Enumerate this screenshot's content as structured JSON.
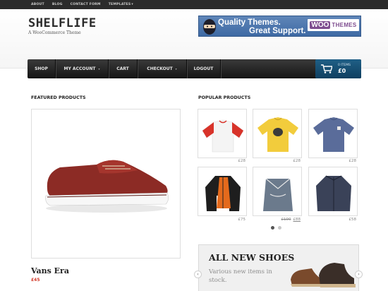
{
  "topbar": {
    "links": [
      "ABOUT",
      "BLOG",
      "CONTACT FORM",
      "TEMPLATES"
    ],
    "dropdown_caret": "▾"
  },
  "header": {
    "logo": "SHELFLIFE",
    "tagline": "A WooCommerce Theme"
  },
  "banner": {
    "line1": "Quality Themes.",
    "line2": "Great Support.",
    "brand_a": "WOO",
    "brand_b": "THEMES"
  },
  "nav": {
    "items": [
      {
        "label": "SHOP",
        "has_dropdown": false
      },
      {
        "label": "MY ACCOUNT",
        "has_dropdown": true
      },
      {
        "label": "CART",
        "has_dropdown": false
      },
      {
        "label": "CHECKOUT",
        "has_dropdown": true
      },
      {
        "label": "LOGOUT",
        "has_dropdown": false
      }
    ],
    "dropdown_caret": "▾"
  },
  "cart": {
    "items": "0 ITEMS",
    "total": "£0",
    "icon": "shopping-cart-icon"
  },
  "featured": {
    "heading": "FEATURED PRODUCTS",
    "product_name": "Vans Era",
    "price": "£45"
  },
  "popular": {
    "heading": "POPULAR PRODUCTS",
    "products": [
      {
        "item": "raglan-tshirt",
        "price": "£28"
      },
      {
        "item": "yellow-tshirt",
        "price": "£28"
      },
      {
        "item": "blue-tshirt",
        "price": "£28"
      },
      {
        "item": "parka-jacket",
        "price": "£75"
      },
      {
        "item": "drawstring-bag",
        "old_price": "£100",
        "price": "£88"
      },
      {
        "item": "navy-jacket",
        "price": "£58"
      }
    ],
    "pagination_active": 1,
    "pagination_count": 2
  },
  "promo": {
    "title": "ALL NEW SHOES",
    "subtitle": "Various new items in stock.",
    "prev": "‹",
    "next": "›"
  },
  "colors": {
    "topbar": "#2b2b2b",
    "nav": "#1f1f1f",
    "cart": "#1a5276",
    "price_red": "#d23a2a",
    "banner_blue": "#4a72ab"
  }
}
